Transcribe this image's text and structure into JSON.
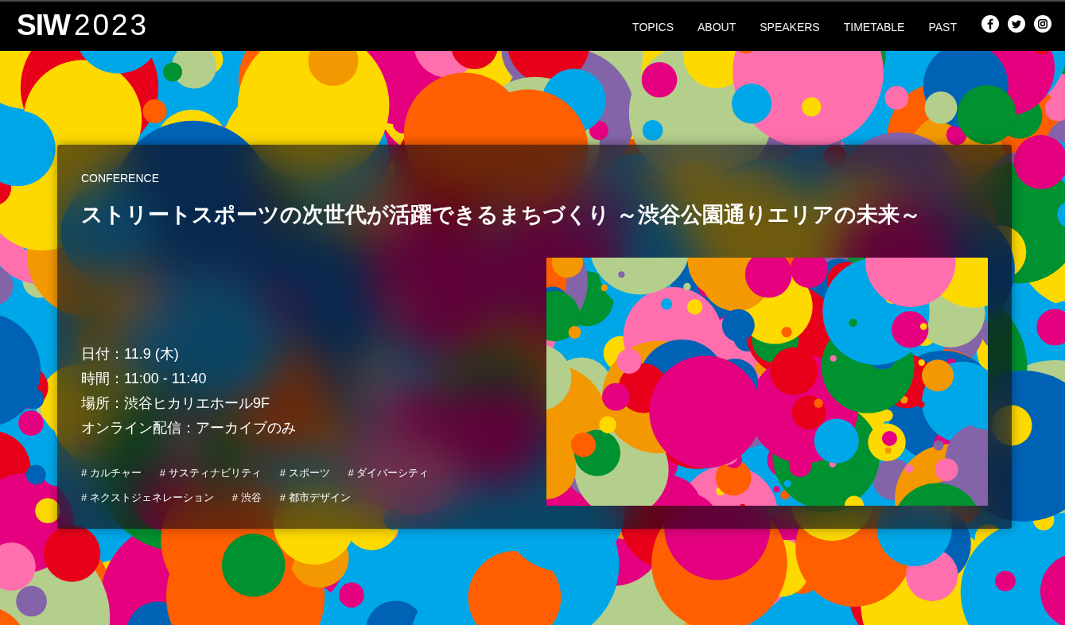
{
  "header": {
    "logo": "**SIW**2023",
    "nav": [
      "TOPICS",
      "ABOUT",
      "SPEAKERS",
      "TIMETABLE",
      "PAST"
    ]
  },
  "event": {
    "category": "CONFERENCE",
    "title": "ストリートスポーツの次世代が活躍できるまちづくり ～渋谷公園通りエリアの未来～",
    "details": [
      "日付：11.9 (木)",
      "時間：11:00 - 11:40",
      "場所：渋谷ヒカリエホール9F",
      "オンライン配信：アーカイブのみ"
    ],
    "tags": [
      "# カルチャー",
      "# サスティナビリティ",
      "# スポーツ",
      "# ダイバーシティ",
      "# ネクストジェネレーション",
      "# 渋谷",
      "# 都市デザイン"
    ]
  }
}
